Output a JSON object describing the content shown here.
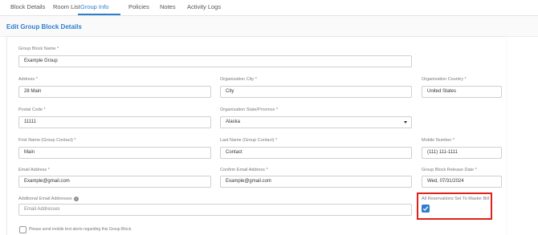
{
  "tabs": [
    {
      "label": "Block Details"
    },
    {
      "label": "Room List"
    },
    {
      "label": "Group Info"
    },
    {
      "label": "Policies"
    },
    {
      "label": "Notes"
    },
    {
      "label": "Activity Logs"
    }
  ],
  "active_tab": "Group Info",
  "page_title": "Edit Group Block Details",
  "accent_color": "#2e7dd1",
  "highlight_color": "#e0201b",
  "form": {
    "group_block_name": {
      "label": "Group Block Name *",
      "value": "Example Group"
    },
    "address": {
      "label": "Address *",
      "value": "28 Main"
    },
    "org_city": {
      "label": "Organization City *",
      "value": "City"
    },
    "org_country": {
      "label": "Organization Country *",
      "value": "United States"
    },
    "postal_code": {
      "label": "Postal Code *",
      "value": "11111"
    },
    "org_state": {
      "label": "Organization State/Province *",
      "value": "Alaska"
    },
    "first_name": {
      "label": "First Name (Group Contact) *",
      "value": "Main"
    },
    "last_name": {
      "label": "Last Name (Group Contact) *",
      "value": "Contact"
    },
    "mobile_number": {
      "label": "Mobile Number *",
      "value": "(111) 111-1111"
    },
    "email": {
      "label": "Email Address *",
      "value": "Example@gmail.com"
    },
    "confirm_email": {
      "label": "Confirm Email Address *",
      "value": "Example@gmail.com"
    },
    "release_date": {
      "label": "Group Block Release Date *",
      "value": "Wed, 07/31/2024"
    },
    "additional_emails": {
      "label": "Additional Email Addresses",
      "placeholder": "Email Addresses"
    },
    "master_bill": {
      "label": "All Reservations Set To Master Bill",
      "checked": true
    },
    "sms_alerts": {
      "label": "Please send mobile text alerts regarding this Group Block.",
      "checked": false
    }
  }
}
